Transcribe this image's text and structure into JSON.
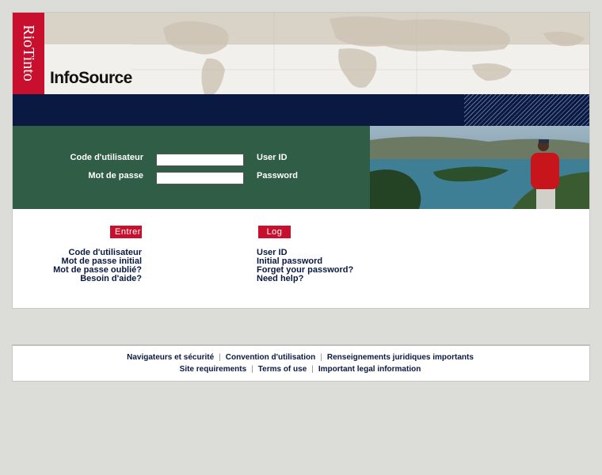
{
  "header": {
    "logo_text": "RioTinto",
    "app_title": "InfoSource"
  },
  "form": {
    "user_label_fr": "Code d'utilisateur",
    "password_label_fr": "Mot de passe",
    "user_label_en": "User ID",
    "password_label_en": "Password",
    "user_value": "",
    "password_value": ""
  },
  "buttons": {
    "enter_fr": "Entrer",
    "login_en": "Log in"
  },
  "help_links_fr": [
    "Code d'utilisateur",
    "Mot de passe initial",
    "Mot de passe oublié?",
    "Besoin d'aide?"
  ],
  "help_links_en": [
    "User ID",
    "Initial password",
    "Forget your password?",
    "Need help?"
  ],
  "footer": {
    "fr": [
      "Navigateurs et sécurité",
      "Convention d'utilisation",
      "Renseignements juridiques importants"
    ],
    "en": [
      "Site requirements",
      "Terms of use",
      "Important legal information"
    ],
    "separator": "|"
  },
  "colors": {
    "brand_red": "#c8102e",
    "navy": "#0a1942",
    "green": "#2f5d45",
    "page_bg": "#dcdcd8"
  }
}
